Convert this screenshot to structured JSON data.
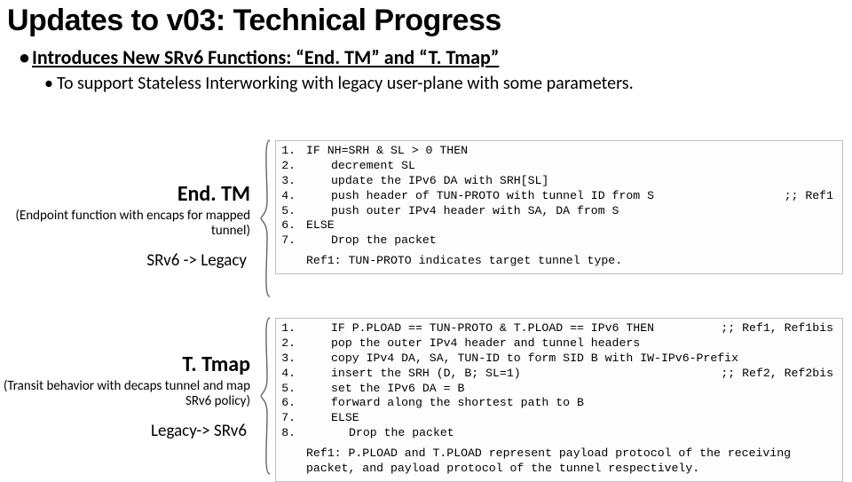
{
  "title": "Updates to v03: Technical Progress",
  "bullet1": "Introduces New SRv6 Functions:  “End. TM” and “T. Tmap”",
  "bullet2": "To support Stateless Interworking with legacy user-plane with some parameters.",
  "endtm": {
    "name": "End. TM",
    "desc": "(Endpoint function with encaps for mapped tunnel)",
    "dir": "SRv6 -> Legacy",
    "code": {
      "l1": "IF NH=SRH & SL > 0 THEN",
      "l2": "decrement SL",
      "l3": "update the IPv6 DA with SRH[SL]",
      "l4": "push header of TUN-PROTO with tunnel ID from S",
      "l4r": ";; Ref1",
      "l5": "push outer IPv4 header with SA, DA from S",
      "l6": "ELSE",
      "l7": "Drop the packet",
      "ref": "Ref1: TUN-PROTO indicates target tunnel type."
    }
  },
  "ttmap": {
    "name": "T. Tmap",
    "desc": "(Transit behavior with decaps tunnel and map SRv6 policy)",
    "dir": "Legacy-> SRv6",
    "code": {
      "l1": "IF P.PLOAD == TUN-PROTO & T.PLOAD == IPv6 THEN",
      "l1r": ";; Ref1, Ref1bis",
      "l2": "pop the outer IPv4 header and tunnel headers",
      "l3": "copy IPv4 DA, SA, TUN-ID to form SID B with IW-IPv6-Prefix",
      "l4": "insert the SRH (D, B; SL=1)",
      "l4r": ";; Ref2, Ref2bis",
      "l5": "set the IPv6 DA = B",
      "l6": "forward along the shortest path to B",
      "l7": "ELSE",
      "l8": "Drop the packet",
      "ref": "Ref1: P.PLOAD and T.PLOAD represent payload protocol of the receiving packet, and payload protocol of the tunnel respectively."
    }
  }
}
